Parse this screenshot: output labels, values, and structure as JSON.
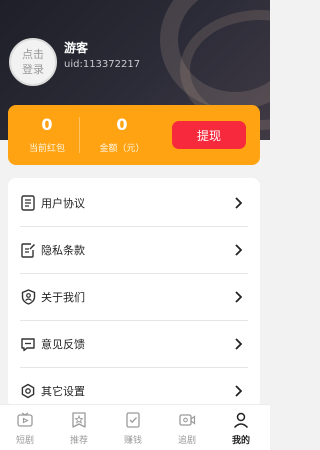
{
  "profile": {
    "avatar_text": "点击登录",
    "name": "游客",
    "uid": "uid:113372217"
  },
  "wallet": {
    "red_packet_value": "0",
    "red_packet_label": "当前红包",
    "amount_value": "0",
    "amount_label": "金额（元）",
    "withdraw_label": "提现"
  },
  "menu": [
    {
      "label": "用户协议",
      "icon": "document-icon"
    },
    {
      "label": "隐私条款",
      "icon": "edit-document-icon"
    },
    {
      "label": "关于我们",
      "icon": "shield-user-icon"
    },
    {
      "label": "意见反馈",
      "icon": "message-icon"
    },
    {
      "label": "其它设置",
      "icon": "gear-icon"
    }
  ],
  "tabs": [
    {
      "label": "短剧",
      "icon": "tv-icon",
      "active": false
    },
    {
      "label": "推荐",
      "icon": "star-badge-icon",
      "active": false
    },
    {
      "label": "赚钱",
      "icon": "checklist-icon",
      "active": false
    },
    {
      "label": "追剧",
      "icon": "video-icon",
      "active": false
    },
    {
      "label": "我的",
      "icon": "person-icon",
      "active": true
    }
  ],
  "colors": {
    "wallet_bg": "#ffa312",
    "withdraw_bg": "#f6293d",
    "header_bg": "#2c2c38"
  }
}
